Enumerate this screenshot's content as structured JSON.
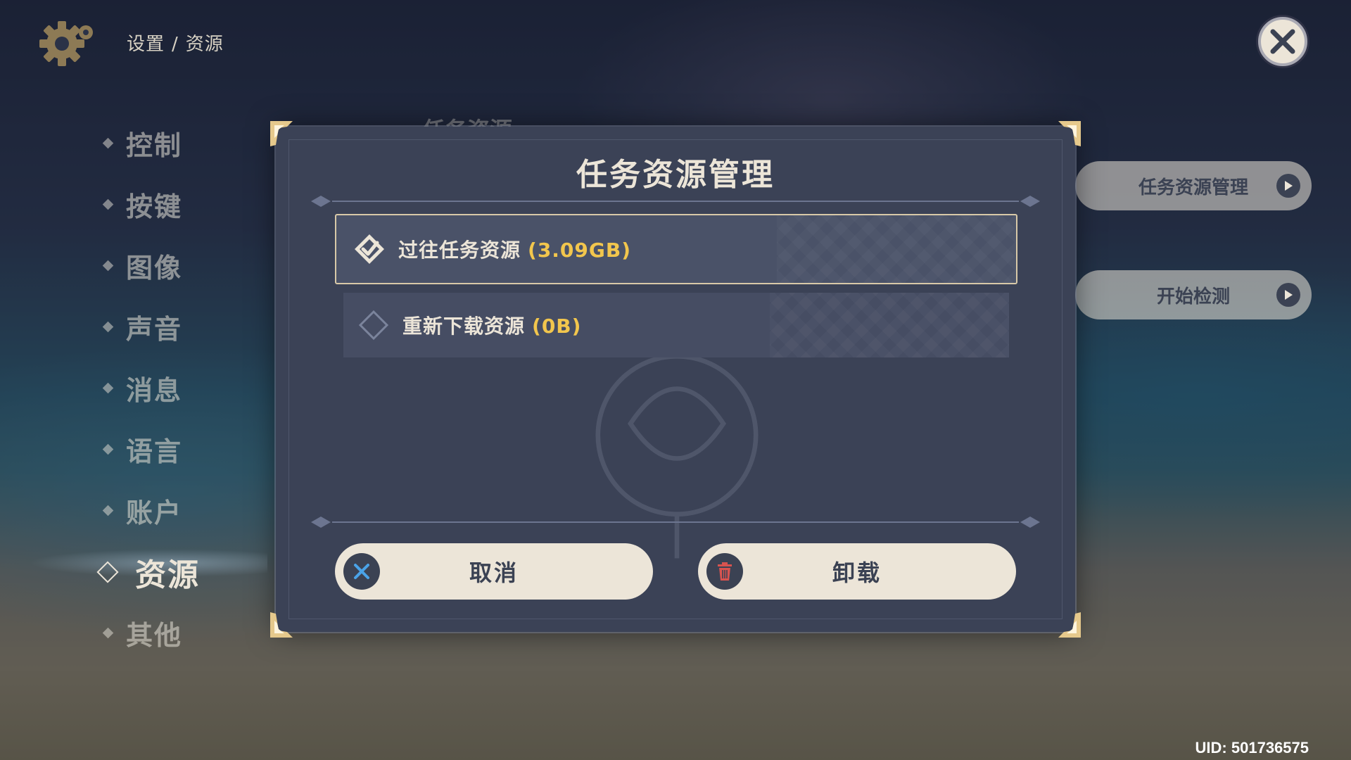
{
  "breadcrumb": {
    "parent": "设置",
    "separator": "/",
    "current": "资源"
  },
  "sidebar": {
    "items": [
      {
        "label": "控制"
      },
      {
        "label": "按键"
      },
      {
        "label": "图像"
      },
      {
        "label": "声音"
      },
      {
        "label": "消息"
      },
      {
        "label": "语言"
      },
      {
        "label": "账户"
      },
      {
        "label": "资源",
        "active": true
      },
      {
        "label": "其他"
      }
    ]
  },
  "background": {
    "section_header": "任务资源"
  },
  "right_panel": {
    "task_resource_button": "任务资源管理",
    "start_check_button": "开始检测"
  },
  "dialog": {
    "title": "任务资源管理",
    "options": [
      {
        "label": "过往任务资源",
        "size": "(3.09GB)",
        "checked": true
      },
      {
        "label": "重新下载资源",
        "size": "(0B)",
        "checked": false
      }
    ],
    "cancel_label": "取消",
    "uninstall_label": "卸载"
  },
  "uid": "UID: 501736575",
  "colors": {
    "accent_gold": "#f2c64d",
    "panel": "#3b4256",
    "button_bg": "#ece5d8",
    "delete_red": "#d9534f",
    "cancel_blue": "#4aa3e8"
  },
  "icons": [
    "gear-icon",
    "close-icon",
    "arrow-right-icon",
    "checkmark-diamond-icon",
    "empty-diamond-icon",
    "x-icon",
    "trash-icon"
  ]
}
